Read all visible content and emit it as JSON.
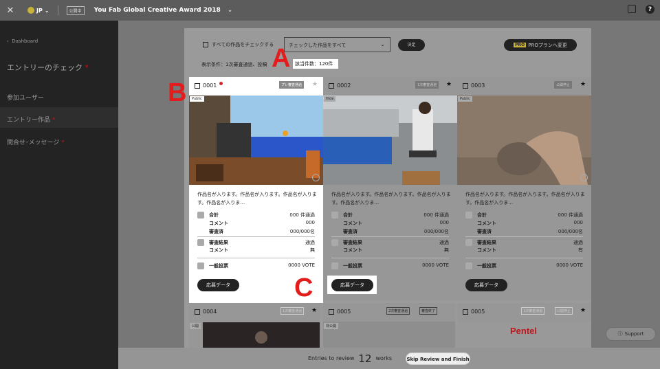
{
  "topbar": {
    "lang": "JP",
    "public_badge": "公開中",
    "title": "You Fab Global Creative Award 2018"
  },
  "sidebar": {
    "back": "Dashboard",
    "heading": "エントリーのチェック",
    "items": [
      {
        "label": "参加ユーザー"
      },
      {
        "label": "エントリー作品"
      },
      {
        "label": "問合せ･メッセージ"
      }
    ]
  },
  "toolbar": {
    "check_all": "すべての作品をチェックする",
    "select_value": "チェックした作品をすべて",
    "decide": "決定",
    "pro_tag": "PRO",
    "pro_label": "PROプランへ変更",
    "condition": "表示条件：1次審査通過、投稿",
    "count": "該当件数：120件"
  },
  "cards": [
    {
      "id": "0001",
      "status": "プレ審査通過",
      "visibility": "Public",
      "desc": "作品名が入ります。作品名が入ります。作品名が入ります。作品名が入りま…",
      "total_label": "合計",
      "total": "000 件通過",
      "comment_label": "コメント",
      "comment": "000",
      "reviewed_label": "審査済",
      "reviewed": "000/000名",
      "result_label": "審査結果",
      "result": "通過",
      "comment2": "無",
      "vote_label": "一般投票",
      "vote": "0000 VOTE",
      "button": "応募データ"
    },
    {
      "id": "0002",
      "status": "1次審査通過",
      "visibility": "Hide",
      "desc": "作品名が入ります。作品名が入ります。作品名が入ります。作品名が入りま…",
      "total_label": "合計",
      "total": "000 件通過",
      "comment_label": "コメント",
      "comment": "000",
      "reviewed_label": "審査済",
      "reviewed": "000/000名",
      "result_label": "審査結果",
      "result": "通過",
      "comment2": "無",
      "vote_label": "一般投票",
      "vote": "0000 VOTE",
      "button": "応募データ"
    },
    {
      "id": "0003",
      "status": "公開停止",
      "visibility": "Public",
      "desc": "作品名が入ります。作品名が入ります。作品名が入ります。作品名が入りま…",
      "total_label": "合計",
      "total": "000 件通過",
      "comment_label": "コメント",
      "comment": "000",
      "reviewed_label": "審査済",
      "reviewed": "000/000名",
      "result_label": "審査結果",
      "result": "通過",
      "comment2": "有",
      "vote_label": "一般投票",
      "vote": "0000 VOTE",
      "button": "応募データ"
    }
  ],
  "cards_row2": [
    {
      "id": "0004",
      "tags": [
        "1次審査通過"
      ],
      "visibility": "公開"
    },
    {
      "id": "0005",
      "tags": [
        "2次審査通過",
        "審査終了"
      ],
      "visibility": "非公開"
    },
    {
      "id": "0005",
      "tags": [
        "1次審査通過",
        "公開停止"
      ],
      "visibility": "",
      "brand": "Pentel"
    }
  ],
  "markers": {
    "a": "A",
    "b": "B",
    "c": "C"
  },
  "footer": {
    "before": "Entries to review",
    "number": "12",
    "after": "works",
    "skip": "Skip Review and Finish"
  },
  "support": "Support"
}
